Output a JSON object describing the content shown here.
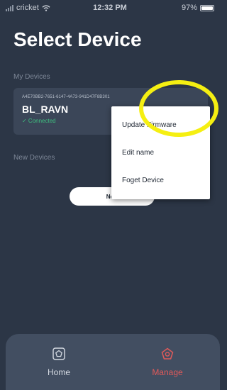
{
  "status_bar": {
    "carrier": "cricket",
    "time": "12:32 PM",
    "battery": "97%",
    "battery_level": 0.97
  },
  "page": {
    "title": "Select Device"
  },
  "my_devices": {
    "label": "My Devices",
    "devices": [
      {
        "uuid": "A4E70BB2-7651-6147-4A73-941D47F8B301",
        "name": "BL_RAVN",
        "status": "✓ Connected"
      }
    ]
  },
  "new_devices": {
    "label": "New Devices",
    "button_label": "New"
  },
  "context_menu": {
    "items": [
      {
        "label": "Update Firmware"
      },
      {
        "label": "Edit name"
      },
      {
        "label": "Foget Device"
      }
    ]
  },
  "tab_bar": {
    "tabs": [
      {
        "label": "Home",
        "icon": "home-pentagon-icon",
        "active": false
      },
      {
        "label": "Manage",
        "icon": "manage-pentagon-icon",
        "active": true
      }
    ]
  },
  "colors": {
    "background": "#2c3646",
    "card": "#3b4658",
    "connected": "#3fbf7f",
    "active_tab": "#e05a5a",
    "inactive_tab": "#d6dbe3",
    "highlight": "#f5ef12"
  }
}
